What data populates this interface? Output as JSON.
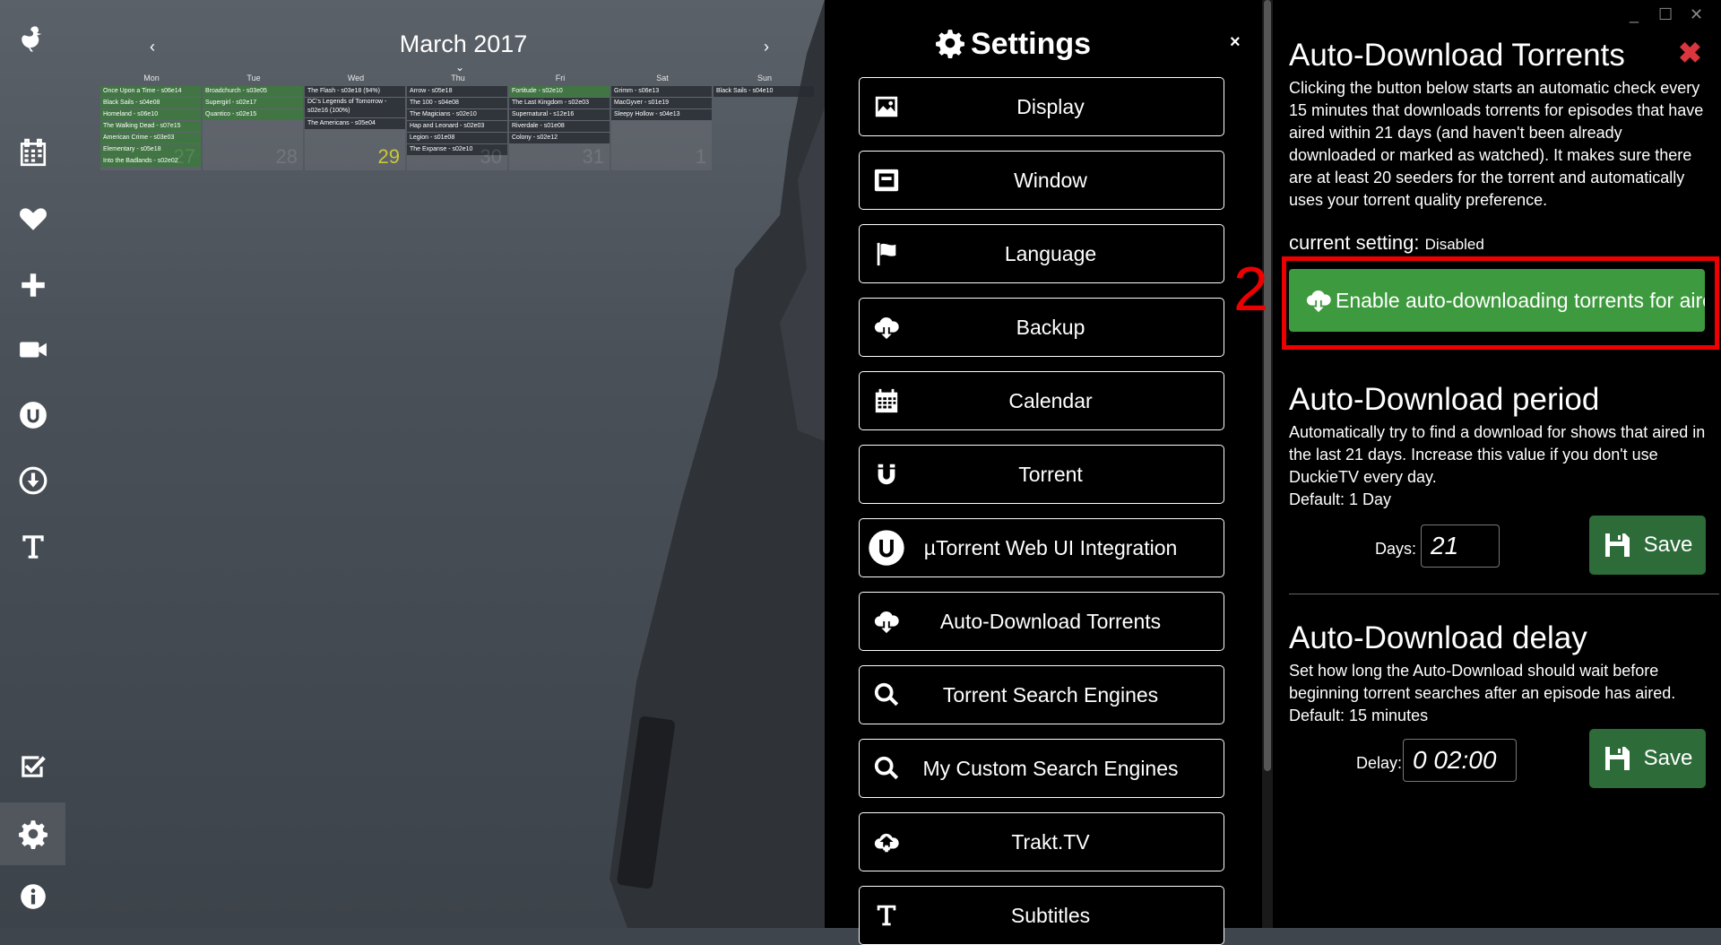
{
  "calendar": {
    "title": "March 2017",
    "prev": "‹",
    "next": "›",
    "down": "⌄",
    "days": [
      "Mon",
      "Tue",
      "Wed",
      "Thu",
      "Fri",
      "Sat",
      "Sun"
    ],
    "cells": [
      {
        "num": "27",
        "events": [
          {
            "t": "Once Upon a Time - s06e14",
            "g": true
          },
          {
            "t": "Black Sails - s04e08",
            "g": true
          },
          {
            "t": "Homeland - s06e10",
            "g": true
          },
          {
            "t": "The Walking Dead - s07e15",
            "g": true
          },
          {
            "t": "American Crime - s03e03",
            "g": true
          },
          {
            "t": "Elementary - s05e18",
            "g": true
          },
          {
            "t": "Into the Badlands - s02e02",
            "g": true
          }
        ]
      },
      {
        "num": "28",
        "events": [
          {
            "t": "Broadchurch - s03e05",
            "g": true
          },
          {
            "t": "Supergirl - s02e17",
            "g": true
          },
          {
            "t": "Quantico - s02e15",
            "g": true
          }
        ]
      },
      {
        "num": "29",
        "today": true,
        "events": [
          {
            "t": "The Flash - s03e18 (94%)",
            "g": false
          },
          {
            "t": "DC's Legends of Tomorrow - s02e16 (100%)",
            "g": false,
            "tall": true
          },
          {
            "t": "The Americans - s05e04",
            "g": false
          }
        ]
      },
      {
        "num": "30",
        "events": [
          {
            "t": "Arrow - s05e18",
            "g": false
          },
          {
            "t": "The 100 - s04e08",
            "g": false
          },
          {
            "t": "The Magicians - s02e10",
            "g": false
          },
          {
            "t": "Hap and Leonard - s02e03",
            "g": false
          },
          {
            "t": "Legion - s01e08",
            "g": false
          },
          {
            "t": "The Expanse - s02e10",
            "g": false
          }
        ]
      },
      {
        "num": "31",
        "events": [
          {
            "t": "Fortitude - s02e10",
            "g": true
          },
          {
            "t": "The Last Kingdom - s02e03",
            "g": false
          },
          {
            "t": "Supernatural - s12e16",
            "g": false
          },
          {
            "t": "Riverdale - s01e08",
            "g": false
          },
          {
            "t": "Colony - s02e12",
            "g": false
          }
        ]
      },
      {
        "num": "1",
        "events": [
          {
            "t": "Grimm - s06e13",
            "g": false
          },
          {
            "t": "MacGyver - s01e19",
            "g": false
          },
          {
            "t": "Sleepy Hollow - s04e13",
            "g": false
          }
        ]
      },
      {
        "num": "",
        "empty": true,
        "events": [
          {
            "t": "Black Sails - s04e10",
            "g": false
          }
        ]
      }
    ]
  },
  "settings": {
    "title": "Settings",
    "close": "×",
    "items": [
      {
        "label": "Display"
      },
      {
        "label": "Window"
      },
      {
        "label": "Language"
      },
      {
        "label": "Backup"
      },
      {
        "label": "Calendar"
      },
      {
        "label": "Torrent"
      },
      {
        "label": "µTorrent Web UI Integration"
      },
      {
        "label": "Auto-Download Torrents"
      },
      {
        "label": "Torrent Search Engines"
      },
      {
        "label": "My Custom Search Engines"
      },
      {
        "label": "Trakt.TV"
      },
      {
        "label": "Subtitles"
      }
    ]
  },
  "window": {
    "minimize": "_",
    "maximize": "☐",
    "close": "✕"
  },
  "panel": {
    "title": "Auto-Download Torrents",
    "close": "✖",
    "description": "Clicking the button below starts an automatic check every 15 minutes that downloads torrents for episodes that have aired within 21 days (and haven't been already downloaded or marked as watched). It makes sure there are at least 20 seeders for the torrent and automatically uses your torrent quality preference.",
    "current_label": "current setting:",
    "current_value": "Disabled",
    "annotation": "2",
    "enable_label": "Enable auto-downloading torrents for aired episodes",
    "period": {
      "title": "Auto-Download period",
      "text": "Automatically try to find a download for shows that aired in the last 21 days. Increase this value if you don't use DuckieTV every day.",
      "default": "Default: 1 Day",
      "field_label": "Days:",
      "value": "21",
      "save": "Save"
    },
    "delay": {
      "title": "Auto-Download delay",
      "text": "Set how long the Auto-Download should wait before beginning torrent searches after an episode has aired.",
      "default": "Default: 15 minutes",
      "field_label": "Delay:",
      "value": "0 02:00",
      "save": "Save"
    }
  },
  "colors": {
    "enable_button": "#3e9a3e",
    "save_button": "#2d6b39",
    "annotation": "#ee0000",
    "close": "#d9363e"
  }
}
